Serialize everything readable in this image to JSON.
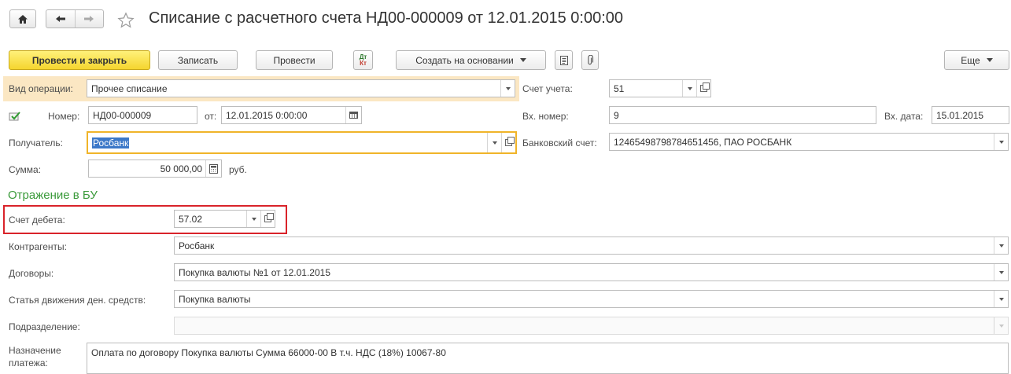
{
  "nav": {
    "home_icon": "home-icon",
    "back_icon": "arrow-left-icon",
    "forward_icon": "arrow-right-icon",
    "favorite_icon": "star-icon"
  },
  "title": "Списание с расчетного счета НД00-000009 от 12.01.2015 0:00:00",
  "toolbar": {
    "post_close": "Провести и закрыть",
    "save": "Записать",
    "post": "Провести",
    "dt_kt_top": "Дт",
    "dt_kt_bottom": "Кт",
    "create_based": "Создать на основании",
    "more": "Еще"
  },
  "form": {
    "op_type_label": "Вид операции:",
    "op_type_value": "Прочее списание",
    "number_label": "Номер:",
    "number_value": "НД00-000009",
    "date_label": "от:",
    "date_value": "12.01.2015  0:00:00",
    "recipient_label": "Получатель:",
    "recipient_value": "Росбанк",
    "sum_label": "Сумма:",
    "sum_value": "50 000,00",
    "currency": "руб.",
    "account_label": "Счет учета:",
    "account_value": "51",
    "in_number_label": "Вх. номер:",
    "in_number_value": "9",
    "in_date_label": "Вх. дата:",
    "in_date_value": "15.01.2015",
    "bank_account_label": "Банковский счет:",
    "bank_account_value": "12465498798784651456, ПАО РОСБАНК"
  },
  "bu": {
    "section_title": "Отражение в БУ",
    "debit_label": "Счет дебета:",
    "debit_value": "57.02",
    "counterparties_label": "Контрагенты:",
    "counterparties_value": "Росбанк",
    "contracts_label": "Договоры:",
    "contracts_value": "Покупка валюты №1 от 12.01.2015",
    "cashflow_label": "Статья движения ден. средств:",
    "cashflow_value": "Покупка валюты",
    "division_label": "Подразделение:",
    "division_value": "",
    "purpose_label_1": "Назначение",
    "purpose_label_2": "платежа:",
    "purpose_value": "Оплата по договору Покупка валюты Сумма 66000-00 В т.ч. НДС  (18%) 10067-80"
  },
  "colors": {
    "primary_button": "#f5d52f",
    "section_title": "#3a9a3a",
    "highlight_frame": "#d9232a",
    "active_field_border": "#f0b429",
    "op_type_bg": "#fbe7c3"
  }
}
